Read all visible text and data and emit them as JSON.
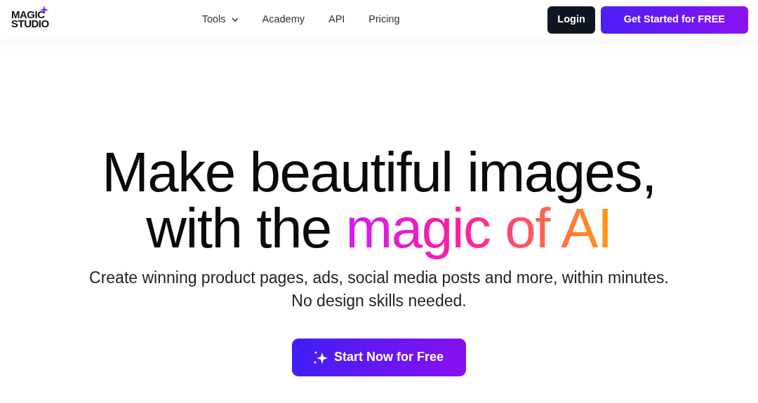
{
  "logo": {
    "line_1": "MAGIC",
    "line_2": "STUDIO"
  },
  "nav": [
    {
      "label": "Tools",
      "dropdown": true
    },
    {
      "label": "Academy",
      "dropdown": false
    },
    {
      "label": "API",
      "dropdown": false
    },
    {
      "label": "Pricing",
      "dropdown": false
    }
  ],
  "actions": {
    "login": "Login",
    "get_started": "Get Started for FREE"
  },
  "hero": {
    "headline_line_1": "Make beautiful images,",
    "headline_line_2": "with the ",
    "headline_highlight": "magic of AI",
    "subtitle_line_1": "Create winning product pages, ads, social media posts and more, within minutes.",
    "subtitle_line_2": "No design skills needed.",
    "cta": "Start Now for Free"
  }
}
